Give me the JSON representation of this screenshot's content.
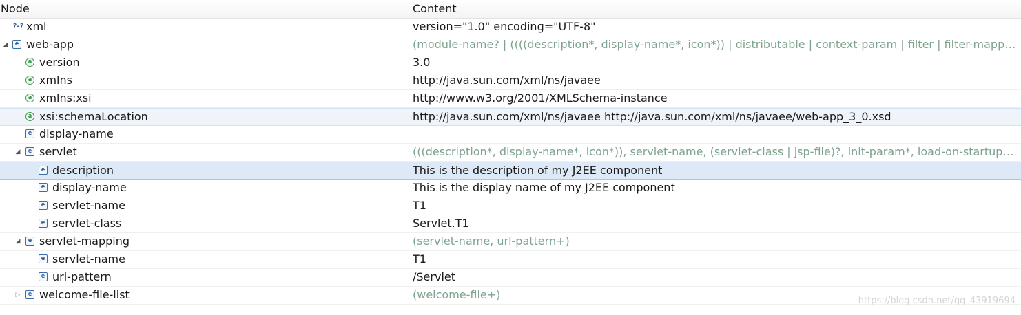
{
  "header": {
    "node_col": "Node",
    "content_col": "Content"
  },
  "rows": [
    {
      "node": "xml",
      "content": "version=\"1.0\" encoding=\"UTF-8\"",
      "icon": "processing-instruction-icon",
      "glyph": "?-?"
    },
    {
      "node": "web-app",
      "content": "(module-name? | ((((description*, display-name*, icon*)) | distributable | context-param | filter | filter-mappi...",
      "icon": "element-icon",
      "glyph": "e",
      "expanded": true
    },
    {
      "node": "version",
      "content": "3.0",
      "icon": "attribute-icon",
      "glyph": "a"
    },
    {
      "node": "xmlns",
      "content": "http://java.sun.com/xml/ns/javaee",
      "icon": "attribute-icon",
      "glyph": "a"
    },
    {
      "node": "xmlns:xsi",
      "content": "http://www.w3.org/2001/XMLSchema-instance",
      "icon": "attribute-icon",
      "glyph": "a"
    },
    {
      "node": "xsi:schemaLocation",
      "content": "http://java.sun.com/xml/ns/javaee http://java.sun.com/xml/ns/javaee/web-app_3_0.xsd",
      "icon": "attribute-icon",
      "glyph": "a",
      "state": "hover"
    },
    {
      "node": "display-name",
      "content": "",
      "icon": "element-icon",
      "glyph": "e"
    },
    {
      "node": "servlet",
      "content": "(((description*, display-name*, icon*)), servlet-name, (servlet-class | jsp-file)?, init-param*, load-on-startup?,...",
      "icon": "element-icon",
      "glyph": "e",
      "expanded": true
    },
    {
      "node": "description",
      "content": "This is the description of my J2EE component",
      "icon": "element-icon",
      "glyph": "e",
      "state": "selected"
    },
    {
      "node": "display-name",
      "content": "This is the display name of my J2EE component",
      "icon": "element-icon",
      "glyph": "e"
    },
    {
      "node": "servlet-name",
      "content": "T1",
      "icon": "element-icon",
      "glyph": "e"
    },
    {
      "node": "servlet-class",
      "content": "Servlet.T1",
      "icon": "element-icon",
      "glyph": "e"
    },
    {
      "node": "servlet-mapping",
      "content": "(servlet-name, url-pattern+)",
      "icon": "element-icon",
      "glyph": "e",
      "expanded": true
    },
    {
      "node": "servlet-name",
      "content": "T1",
      "icon": "element-icon",
      "glyph": "e"
    },
    {
      "node": "url-pattern",
      "content": "/Servlet",
      "icon": "element-icon",
      "glyph": "e"
    },
    {
      "node": "welcome-file-list",
      "content": "(welcome-file+)",
      "icon": "element-icon",
      "glyph": "e",
      "expanded": false
    }
  ],
  "watermark": "https://blog.csdn.net/qq_43919694",
  "colors": {
    "selection": "#dde9f6",
    "hover": "#eef4fa",
    "content_model_text": "#7ea38f"
  }
}
